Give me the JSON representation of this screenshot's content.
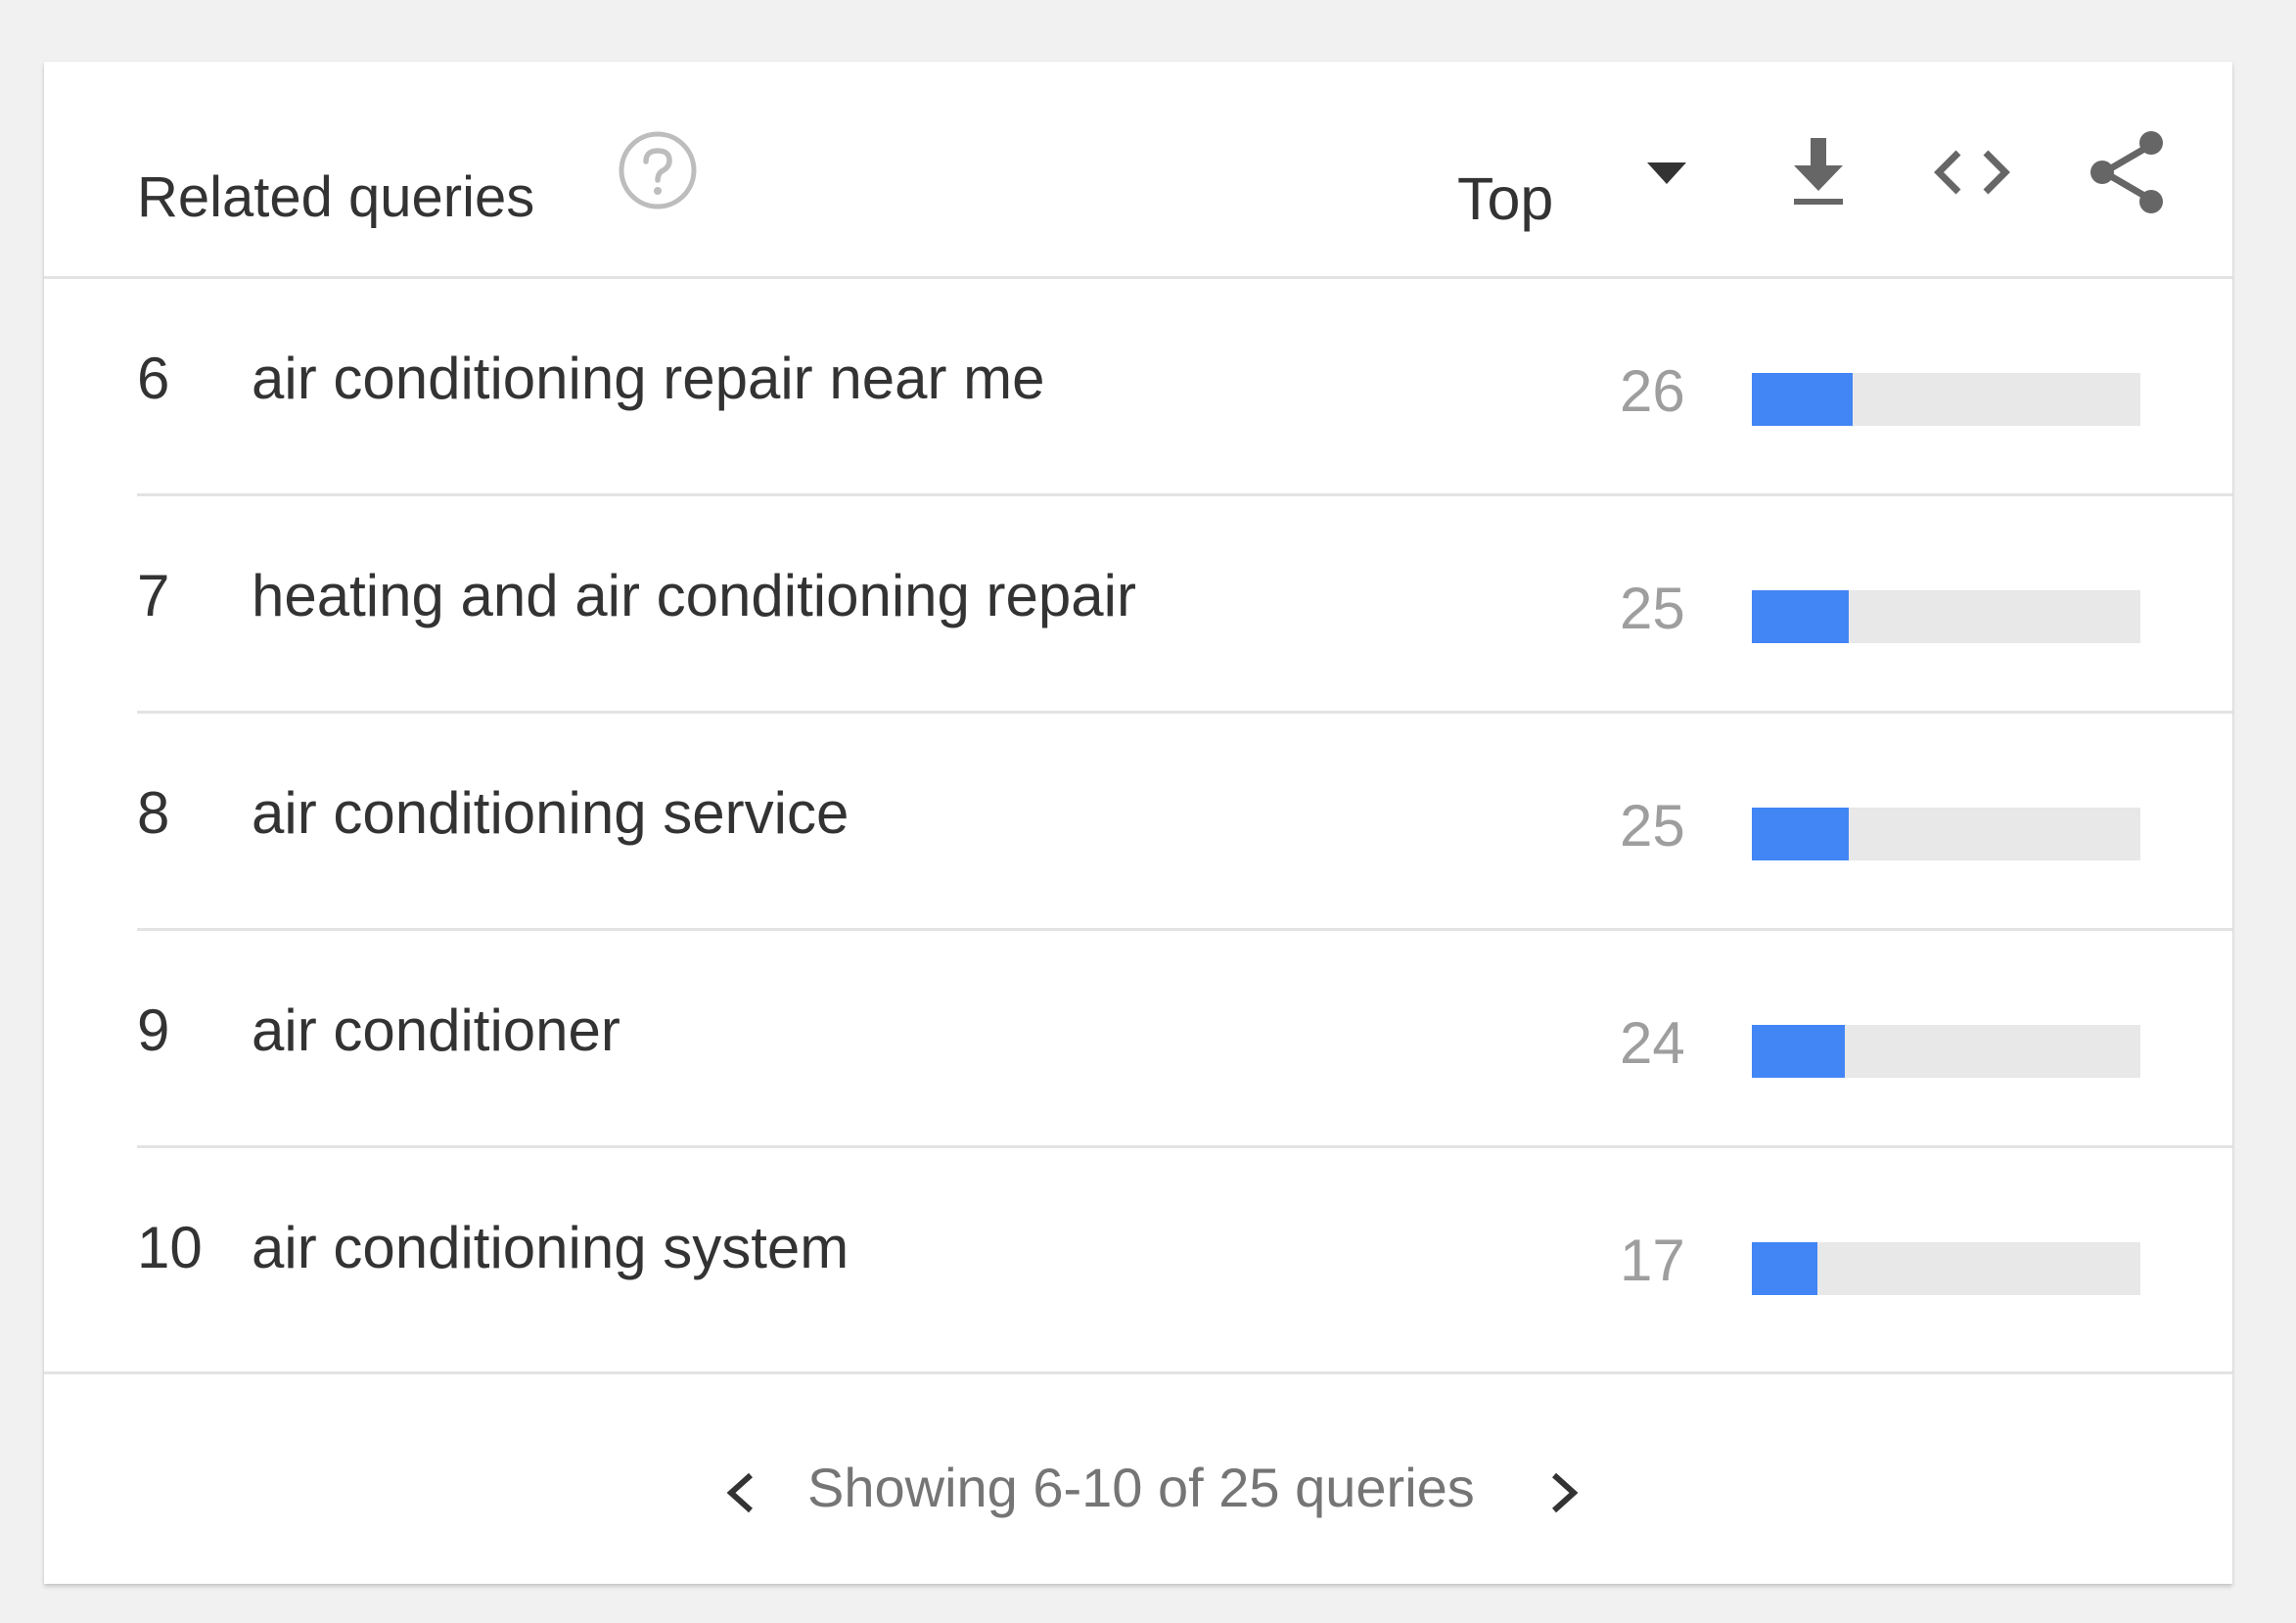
{
  "header": {
    "title": "Related queries",
    "help_icon": "help-circle-icon",
    "select_value": "Top",
    "icons": [
      "chevron-down-icon",
      "download-icon",
      "embed-code-icon",
      "share-icon"
    ]
  },
  "rows": [
    {
      "rank": "6",
      "query": "air conditioning repair near me",
      "value": "26",
      "bar_percent": 26
    },
    {
      "rank": "7",
      "query": "heating and air conditioning repair",
      "value": "25",
      "bar_percent": 25
    },
    {
      "rank": "8",
      "query": "air conditioning service",
      "value": "25",
      "bar_percent": 25
    },
    {
      "rank": "9",
      "query": "air conditioner",
      "value": "24",
      "bar_percent": 24
    },
    {
      "rank": "10",
      "query": "air conditioning system",
      "value": "17",
      "bar_percent": 17
    }
  ],
  "footer": {
    "pagination_text": "Showing 6-10 of 25 queries",
    "icons": [
      "chevron-left-icon",
      "chevron-right-icon"
    ]
  },
  "colors": {
    "accent": "#4285f4",
    "bar_track": "#e8e8e8",
    "text_primary": "#333333",
    "text_secondary": "#9e9e9e"
  }
}
